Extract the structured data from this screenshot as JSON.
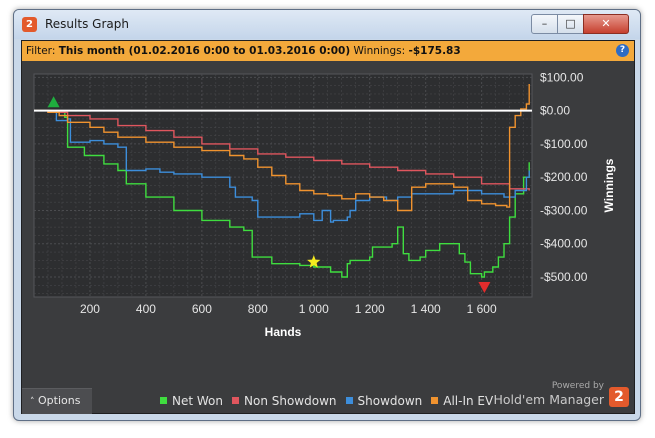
{
  "window": {
    "title": "Results Graph",
    "app_icon": "hm2-icon",
    "controls": {
      "minimize_glyph": "–",
      "maximize_glyph": "□",
      "close_glyph": "✕"
    }
  },
  "filter": {
    "label": "Filter:",
    "value": "This month (01.02.2016 0:00 to 01.03.2016 0:00)",
    "winnings_label": "Winnings:",
    "winnings_value": "-$175.83",
    "help_glyph": "?"
  },
  "options_button": {
    "label": "Options",
    "glyph": "˄"
  },
  "brand": {
    "powered_by": "Powered by",
    "name": "Hold'em Manager",
    "logo": "2"
  },
  "colors": {
    "background": "#3b3c3e",
    "plot_bg": "#2d2e30",
    "grid": "#4b4c4f",
    "zero_line": "#ffffff",
    "accent_filter": "#f3a93b"
  },
  "chart_data": {
    "type": "line",
    "xlabel": "Hands",
    "ylabel": "Winnings",
    "xlim": [
      0,
      1780
    ],
    "ylim": [
      -560,
      110
    ],
    "x_ticks": [
      200,
      400,
      600,
      800,
      1000,
      1200,
      1400,
      1600
    ],
    "x_tick_labels": [
      "200",
      "400",
      "600",
      "800",
      "1 000",
      "1 200",
      "1 400",
      "1 600"
    ],
    "y_ticks": [
      100,
      0,
      -100,
      -200,
      -300,
      -400,
      -500
    ],
    "y_tick_labels": [
      "$100.00",
      "$0.00",
      "-$100.00",
      "-$200.00",
      "-$300.00",
      "-$400.00",
      "-$500.00"
    ],
    "grid": true,
    "legend": "bottom",
    "series": [
      {
        "name": "Net Won",
        "color": "#3fdd3f",
        "x": [
          0,
          60,
          110,
          120,
          180,
          250,
          300,
          330,
          400,
          500,
          600,
          700,
          750,
          780,
          850,
          950,
          1000,
          1060,
          1100,
          1120,
          1130,
          1200,
          1210,
          1280,
          1300,
          1320,
          1340,
          1380,
          1400,
          1450,
          1520,
          1540,
          1560,
          1600,
          1610,
          1640,
          1660,
          1680,
          1700,
          1720,
          1750,
          1770
        ],
        "y": [
          0,
          -5,
          -20,
          -110,
          -135,
          -160,
          -180,
          -220,
          -260,
          -300,
          -330,
          -350,
          -360,
          -440,
          -460,
          -465,
          -470,
          -485,
          -500,
          -460,
          -450,
          -440,
          -410,
          -400,
          -350,
          -430,
          -450,
          -440,
          -420,
          -400,
          -430,
          -455,
          -490,
          -500,
          -485,
          -470,
          -440,
          -400,
          -320,
          -250,
          -200,
          -155
        ]
      },
      {
        "name": "Non Showdown",
        "color": "#e0565e",
        "x": [
          0,
          50,
          120,
          200,
          300,
          400,
          500,
          600,
          700,
          800,
          900,
          1000,
          1100,
          1200,
          1300,
          1400,
          1500,
          1600,
          1700,
          1770
        ],
        "y": [
          0,
          -5,
          -15,
          -25,
          -45,
          -60,
          -80,
          -100,
          -115,
          -130,
          -140,
          -150,
          -160,
          -170,
          -180,
          -190,
          -200,
          -220,
          -235,
          -240
        ]
      },
      {
        "name": "Showdown",
        "color": "#3d8edb",
        "x": [
          0,
          50,
          80,
          120,
          130,
          200,
          250,
          300,
          330,
          400,
          450,
          500,
          600,
          700,
          720,
          780,
          800,
          900,
          950,
          1000,
          1030,
          1060,
          1070,
          1120,
          1130,
          1150,
          1200,
          1260,
          1300,
          1350,
          1400,
          1500,
          1600,
          1680,
          1720,
          1760,
          1770
        ],
        "y": [
          0,
          -5,
          -30,
          -25,
          -95,
          -90,
          -100,
          -110,
          -180,
          -175,
          -185,
          -190,
          -200,
          -230,
          -260,
          -270,
          -320,
          -320,
          -310,
          -330,
          -300,
          -335,
          -330,
          -320,
          -300,
          -270,
          -260,
          -270,
          -260,
          -250,
          -250,
          -240,
          -250,
          -260,
          -240,
          -200,
          -180
        ]
      },
      {
        "name": "All-In EV",
        "color": "#f0932f",
        "x": [
          0,
          50,
          90,
          120,
          200,
          250,
          300,
          400,
          500,
          600,
          700,
          750,
          800,
          850,
          900,
          950,
          1000,
          1050,
          1100,
          1150,
          1200,
          1250,
          1300,
          1350,
          1400,
          1500,
          1550,
          1600,
          1650,
          1690,
          1700,
          1720,
          1740,
          1760,
          1770
        ],
        "y": [
          0,
          -5,
          -15,
          -35,
          -50,
          -65,
          -80,
          -95,
          -110,
          -120,
          -135,
          -145,
          -170,
          -195,
          -220,
          -240,
          -250,
          -255,
          -265,
          -250,
          -260,
          -270,
          -300,
          -230,
          -220,
          -230,
          -270,
          -280,
          -285,
          -290,
          -50,
          -15,
          5,
          20,
          80
        ]
      }
    ],
    "markers": [
      {
        "name": "start-marker",
        "shape": "triangle-up",
        "color": "#1fae3e",
        "x": 70,
        "y": 25
      },
      {
        "name": "max-marker",
        "shape": "star",
        "color": "#f5ea1e",
        "x": 1000,
        "y": -455
      },
      {
        "name": "min-marker",
        "shape": "triangle-down",
        "color": "#e22c2c",
        "x": 1610,
        "y": -530
      }
    ]
  }
}
